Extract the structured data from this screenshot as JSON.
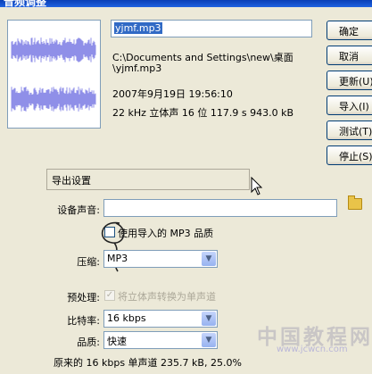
{
  "window": {
    "title": "音频调整"
  },
  "file": {
    "name_value": "yjmf.mp3",
    "path_line1": "C:\\Documents and Settings\\new\\桌面",
    "path_line2": "\\yjmf.mp3",
    "date": "2007年9月19日   19:56:10",
    "properties": "22 kHz 立体声 16 位 117.9 s 943.0 kB"
  },
  "buttons": {
    "ok": "确定",
    "cancel": "取消",
    "update": "更新(U)",
    "import": "导入(I)",
    "test": "测试(T)",
    "stop": "停止(S)"
  },
  "export": {
    "section_title": "导出设置",
    "device_sound_label": "设备声音:",
    "device_sound_value": "",
    "use_import_quality_label": "使用导入的 MP3 品质",
    "use_import_quality_checked": false,
    "compression_label": "压缩:",
    "compression_value": "MP3",
    "preprocess_label": "预处理:",
    "preprocess_option": "将立体声转换为单声道",
    "preprocess_checked": true,
    "bitrate_label": "比特率:",
    "bitrate_value": "16 kbps",
    "quality_label": "品质:",
    "quality_value": "快速",
    "summary": "原来的 16 kbps  单声道 235.7 kB, 25.0%"
  },
  "watermark": {
    "main": "中国教程网",
    "sub": "www.jcwcn.com"
  },
  "colors": {
    "waveform": "#8f8fe8",
    "selection": "#316ac5",
    "titlebar": "#0a3fb6"
  },
  "icons": [
    "folder-icon",
    "chevron-down-icon",
    "checkmark-icon"
  ]
}
